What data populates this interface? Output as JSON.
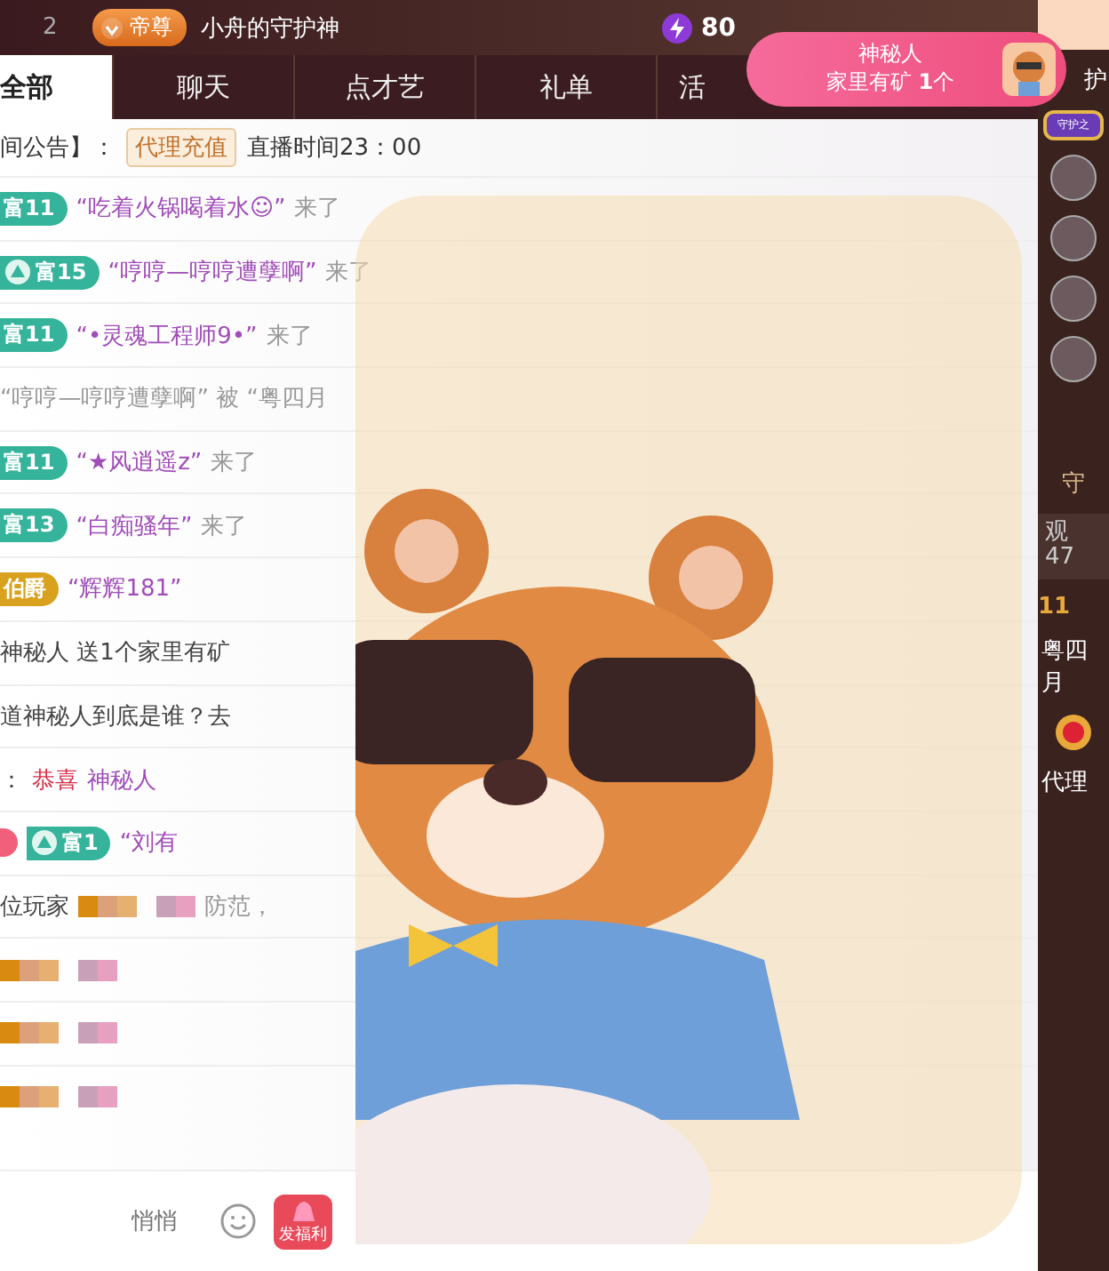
{
  "rank_row": {
    "rank": "2",
    "badge": "帝尊",
    "name": "小舟的守护神",
    "score": "80"
  },
  "tabs": [
    {
      "label": "全部",
      "selected": true
    },
    {
      "label": "聊天",
      "selected": false
    },
    {
      "label": "点才艺",
      "selected": false
    },
    {
      "label": "礼单",
      "selected": false
    },
    {
      "label": "活",
      "selected": false
    }
  ],
  "popup": {
    "title": "神秘人",
    "text": "家里有矿 **1**个"
  },
  "announcement": {
    "label": "间公告】：",
    "tag": "代理充值",
    "text": "直播时间23：00"
  },
  "messages": [
    {
      "badges": [
        {
          "text": "富11",
          "color": "#35b39b",
          "emblem": false
        }
      ],
      "name": "“吃着火锅喝着水☺”",
      "text": "来了"
    },
    {
      "badges": [
        {
          "text": "富15",
          "color": "#35b39b",
          "emblem": true
        }
      ],
      "name": "“哼哼—哼哼遭孽啊”",
      "text": "来了"
    },
    {
      "badges": [
        {
          "text": "富11",
          "color": "#35b39b",
          "emblem": false
        }
      ],
      "name": "“•灵魂工程师9•”",
      "text": "来了"
    },
    {
      "text": "“哼哼—哼哼遭孽啊” 被 “粤四月"
    },
    {
      "badges": [
        {
          "text": "富11",
          "color": "#35b39b",
          "emblem": false
        }
      ],
      "name": "“★风逍遥z”",
      "text": "来了"
    },
    {
      "badges": [
        {
          "text": "富13",
          "color": "#35b39b",
          "emblem": false
        }
      ],
      "name": "“白痴骚年”",
      "text": "来了"
    },
    {
      "badges": [
        {
          "text": "伯爵",
          "color": "#d9a21e",
          "emblem": false
        }
      ],
      "name": "“辉辉181”"
    },
    {
      "prefix": "神秘人 送1个家里有矿"
    },
    {
      "prefix": "道神秘人到底是谁？去"
    },
    {
      "prefix": "：",
      "highlight": "恭喜",
      "name": "神秘人"
    },
    {
      "badges": [
        {
          "color": "#f0607a",
          "emblem": false
        },
        {
          "text": "富1",
          "color": "#35b39b",
          "emblem": true
        }
      ],
      "name": "“刘有"
    },
    {
      "prefix": "位玩家",
      "mosaic": true,
      "text": "防范，"
    },
    {
      "mosaic": true
    },
    {
      "mosaic": true
    },
    {
      "mosaic": true
    }
  ],
  "input": {
    "placeholder": "悄悄",
    "gift_label": "发福利"
  },
  "side": {
    "top_label": "护",
    "medal_text": "守护之",
    "guard_label": "守",
    "viewers_label": "观",
    "viewers_count": "47",
    "rank_level": "11",
    "rank_name": "粤四月",
    "agent_name": "代理"
  }
}
